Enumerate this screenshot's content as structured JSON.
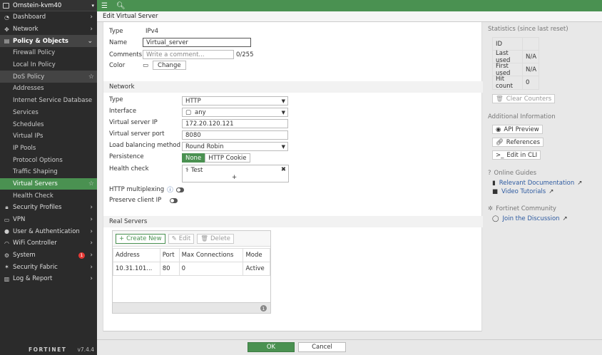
{
  "sidebar": {
    "device": "Ornstein-kvm40",
    "items": [
      {
        "label": "Dashboard",
        "icon": "dashboard-icon"
      },
      {
        "label": "Network",
        "icon": "network-icon"
      },
      {
        "label": "Policy & Objects",
        "icon": "policy-icon"
      },
      {
        "label": "Firewall Policy"
      },
      {
        "label": "Local In Policy"
      },
      {
        "label": "DoS Policy"
      },
      {
        "label": "Addresses"
      },
      {
        "label": "Internet Service Database"
      },
      {
        "label": "Services"
      },
      {
        "label": "Schedules"
      },
      {
        "label": "Virtual IPs"
      },
      {
        "label": "IP Pools"
      },
      {
        "label": "Protocol Options"
      },
      {
        "label": "Traffic Shaping"
      },
      {
        "label": "Virtual Servers"
      },
      {
        "label": "Health Check"
      },
      {
        "label": "Security Profiles",
        "icon": "lock-icon"
      },
      {
        "label": "VPN",
        "icon": "vpn-icon"
      },
      {
        "label": "User & Authentication",
        "icon": "user-icon"
      },
      {
        "label": "WiFi Controller",
        "icon": "wifi-icon"
      },
      {
        "label": "System",
        "icon": "gear-icon",
        "badge": "1"
      },
      {
        "label": "Security Fabric",
        "icon": "fabric-icon"
      },
      {
        "label": "Log & Report",
        "icon": "log-icon"
      }
    ],
    "logo": "FORTINET",
    "version": "v7.4.4"
  },
  "header": {
    "title": "Edit Virtual Server"
  },
  "form": {
    "type_label": "Type",
    "type_value": "IPv4",
    "name_label": "Name",
    "name_value": "Virtual_server",
    "comments_label": "Comments",
    "comments_placeholder": "Write a comment...",
    "comments_count": "0/255",
    "color_label": "Color",
    "color_button": "Change",
    "network_section": "Network",
    "net_type_label": "Type",
    "net_type_value": "HTTP",
    "interface_label": "Interface",
    "interface_value": "any",
    "vip_label": "Virtual server IP",
    "vip_value": "172.20.120.121",
    "vport_label": "Virtual server port",
    "vport_value": "8080",
    "lb_label": "Load balancing method",
    "lb_value": "Round Robin",
    "persist_label": "Persistence",
    "persist_none": "None",
    "persist_cookie": "HTTP Cookie",
    "health_label": "Health check",
    "health_value": "Test",
    "multiplex_label": "HTTP multiplexing",
    "preserve_label": "Preserve client IP",
    "real_section": "Real Servers",
    "create_new": "Create New",
    "edit": "Edit",
    "delete": "Delete",
    "columns": [
      "Address",
      "Port",
      "Max Connections",
      "Mode"
    ],
    "rows": [
      [
        "10.31.101...",
        "80",
        "0",
        "Active"
      ]
    ],
    "count": "1"
  },
  "right": {
    "stats_title": "Statistics (since last reset)",
    "stats": [
      [
        "ID",
        ""
      ],
      [
        "Last used",
        "N/A"
      ],
      [
        "First used",
        "N/A"
      ],
      [
        "Hit count",
        "0"
      ]
    ],
    "clear_counters": "Clear Counters",
    "info_title": "Additional Information",
    "api_preview": "API Preview",
    "references": "References",
    "edit_cli": "Edit in CLI",
    "guides_title": "Online Guides",
    "relevant_docs": "Relevant Documentation",
    "video_tutorials": "Video Tutorials",
    "community_title": "Fortinet Community",
    "join_discussion": "Join the Discussion"
  },
  "footer": {
    "ok": "OK",
    "cancel": "Cancel"
  }
}
